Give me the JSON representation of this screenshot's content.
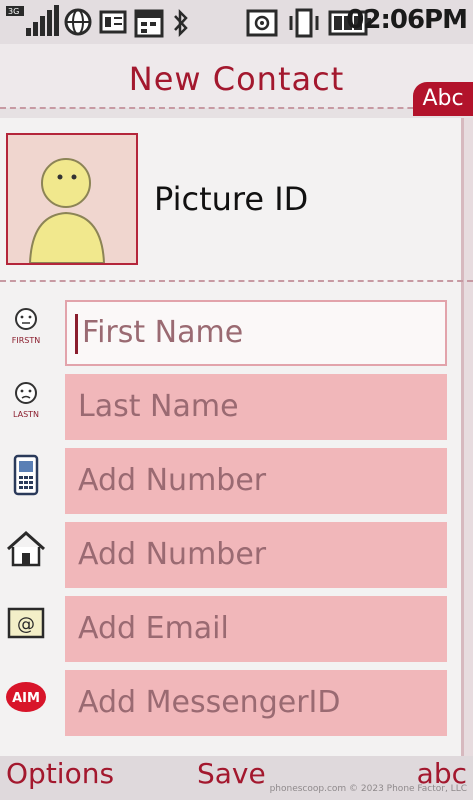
{
  "status_bar": {
    "network": "3G",
    "time": "02:06PM",
    "icons": [
      "signal-strength-icon",
      "network-3g-icon",
      "globe-icon",
      "message-icon",
      "calendar-icon",
      "bluetooth-icon",
      "email-status-icon",
      "vibrate-icon",
      "battery-icon"
    ]
  },
  "header": {
    "title": "New Contact",
    "input_mode": "Abc"
  },
  "picture": {
    "label": "Picture ID"
  },
  "fields": [
    {
      "icon": "first-name-icon",
      "icon_label": "FIRSTN",
      "placeholder": "First Name",
      "active": true
    },
    {
      "icon": "last-name-icon",
      "icon_label": "LASTN",
      "placeholder": "Last Name",
      "active": false
    },
    {
      "icon": "mobile-phone-icon",
      "icon_label": "",
      "placeholder": "Add Number",
      "active": false
    },
    {
      "icon": "home-icon",
      "icon_label": "",
      "placeholder": "Add Number",
      "active": false
    },
    {
      "icon": "email-icon",
      "icon_label": "",
      "placeholder": "Add Email",
      "active": false
    },
    {
      "icon": "aim-icon",
      "icon_label": "AIM",
      "placeholder": "Add MessengerID",
      "active": false
    }
  ],
  "softkeys": {
    "left": "Options",
    "center": "Save",
    "right": "abc"
  },
  "footer": {
    "watermark": "phonescoop.com  © 2023 Phone Factor, LLC"
  },
  "colors": {
    "accent": "#a3182e",
    "field_bg": "#f1b7ba",
    "field_text": "#9a6a72"
  }
}
